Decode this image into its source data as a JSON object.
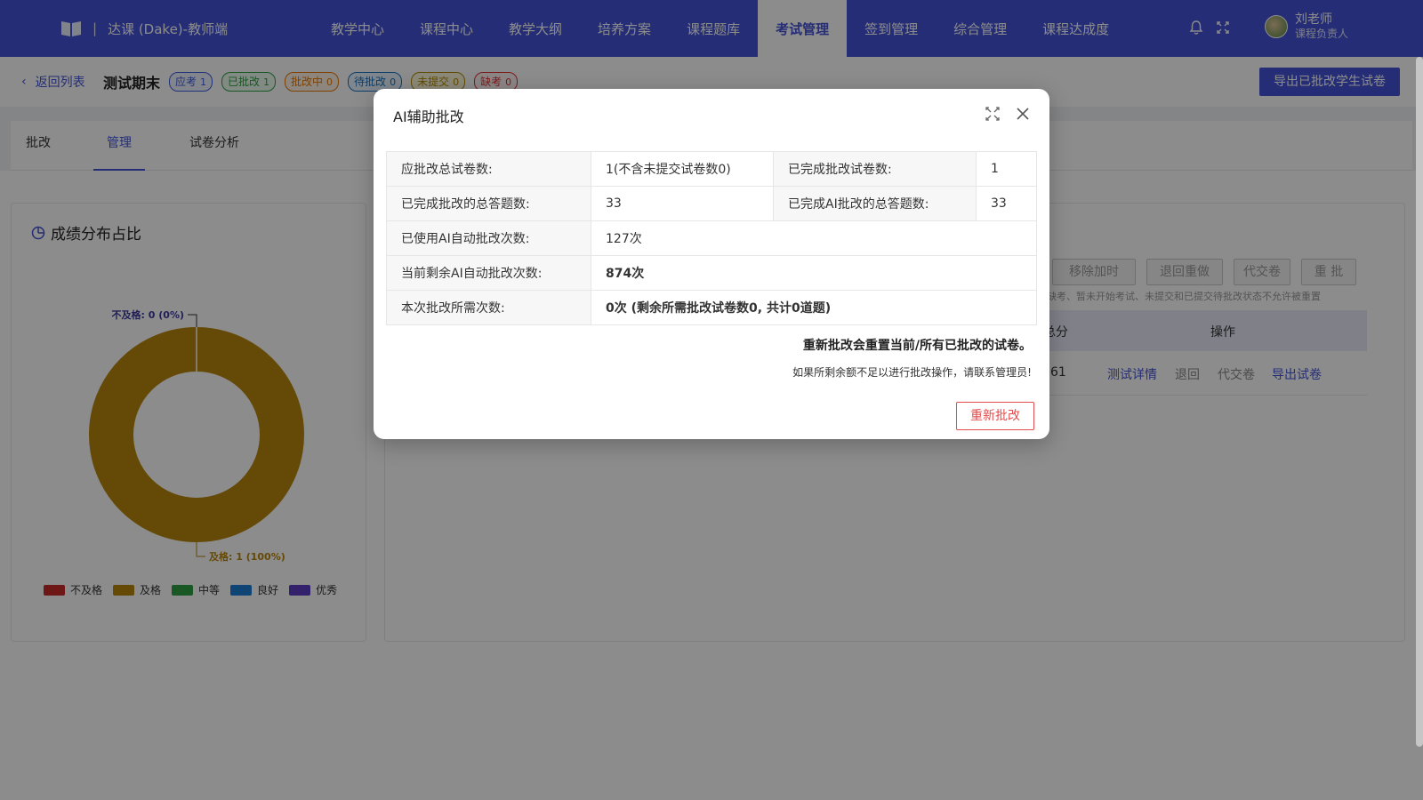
{
  "app": {
    "title": "达课 (Dake)-教师端",
    "separator": "|"
  },
  "nav": [
    "教学中心",
    "课程中心",
    "教学大纲",
    "培养方案",
    "课程题库",
    "考试管理",
    "签到管理",
    "综合管理",
    "课程达成度"
  ],
  "nav_active_index": 5,
  "user": {
    "name": "刘老师",
    "role": "课程负责人"
  },
  "subheader": {
    "back_label": "返回列表",
    "exam_title": "测试期末",
    "badges": [
      {
        "label": "应考",
        "count": "1",
        "color": "#3b5bdb"
      },
      {
        "label": "已批改",
        "count": "1",
        "color": "#2f9e44"
      },
      {
        "label": "批改中",
        "count": "0",
        "color": "#e67700"
      },
      {
        "label": "待批改",
        "count": "0",
        "color": "#1971c2"
      },
      {
        "label": "未提交",
        "count": "0",
        "color": "#b08900"
      },
      {
        "label": "缺考",
        "count": "0",
        "color": "#e03131"
      }
    ],
    "export_button": "导出已批改学生试卷"
  },
  "tabs": [
    "批改",
    "管理",
    "试卷分析"
  ],
  "tab_active_index": 1,
  "score_card": {
    "title": "成绩分布占比",
    "chart_data": {
      "type": "pie",
      "categories": [
        "不及格",
        "及格",
        "中等",
        "良好",
        "优秀"
      ],
      "values": [
        0,
        1,
        0,
        0,
        0
      ],
      "percents": [
        "0%",
        "100%",
        "0%",
        "0%",
        "0%"
      ],
      "colors": [
        "#c92a2a",
        "#b8860b",
        "#2f9e44",
        "#1c7ed6",
        "#5f3dc4"
      ],
      "labels": {
        "fail": "不及格: 0 (0%)",
        "pass": "及格: 1 (100%)"
      },
      "legend_position": "bottom"
    }
  },
  "right_panel": {
    "buttons": [
      "移除加时",
      "退回重做",
      "代交卷",
      "重 批"
    ],
    "hint": "缺考、暂未开始考试、未提交和已提交待批改状态不允许被重置",
    "table": {
      "headers": [
        "总分",
        "操作"
      ],
      "rows": [
        {
          "total": "61",
          "actions": [
            "测试详情",
            "退回",
            "代交卷",
            "导出试卷"
          ]
        }
      ]
    }
  },
  "modal": {
    "title": "AI辅助批改",
    "rows": [
      {
        "label": "应批改总试卷数:",
        "value": "1(不含未提交试卷数0)",
        "label2": "已完成批改试卷数:",
        "value2": "1"
      },
      {
        "label": "已完成批改的总答题数:",
        "value": "33",
        "label2": "已完成AI批改的总答题数:",
        "value2": "33"
      },
      {
        "label": "已使用AI自动批改次数:",
        "value": "127次"
      },
      {
        "label": "当前剩余AI自动批改次数:",
        "value": "874次"
      },
      {
        "label": "本次批改所需次数:",
        "value": "0次 (剩余所需批改试卷数0, 共计0道题)"
      }
    ],
    "warning": "重新批改会重置当前/所有已批改的试卷。",
    "note": "如果所剩余额不足以进行批改操作，请联系管理员!",
    "regrade_button": "重新批改",
    "colors": {
      "remaining": "#2b2fc4",
      "required": "#e08a00"
    }
  }
}
